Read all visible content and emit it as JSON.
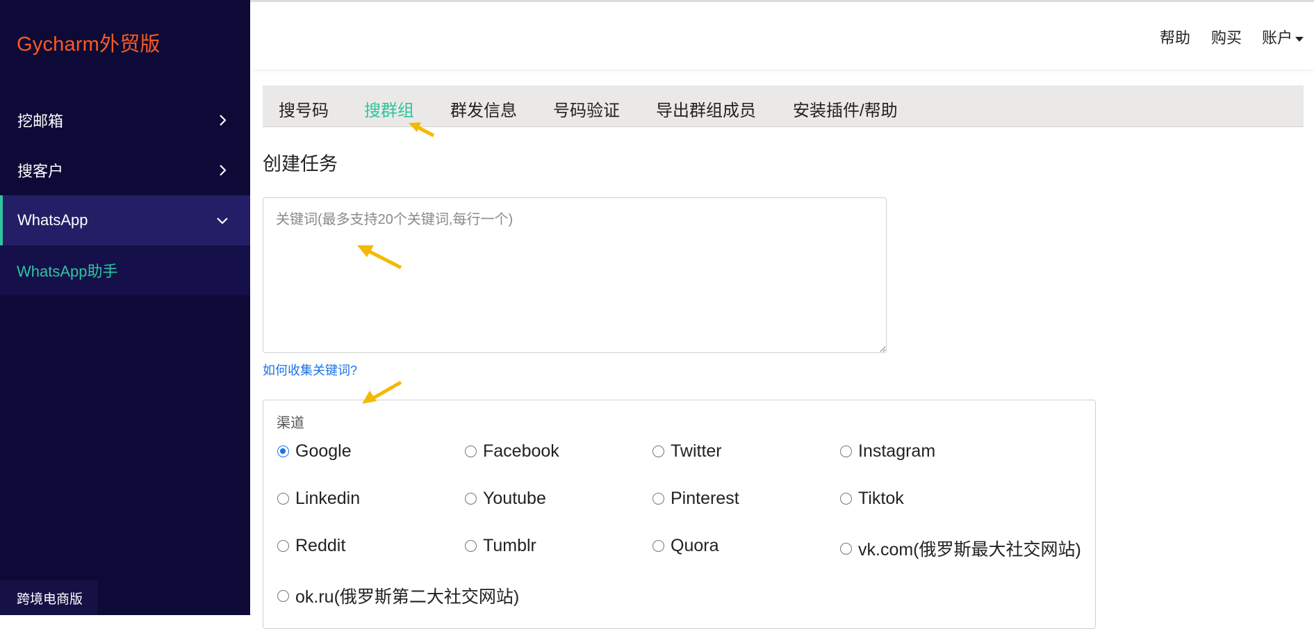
{
  "app": {
    "brand": "Gycharm外贸版",
    "footer": "跨境电商版"
  },
  "sidebar": {
    "items": [
      {
        "label": "挖邮箱",
        "icon": "chevron-right-icon"
      },
      {
        "label": "搜客户",
        "icon": "chevron-right-icon"
      },
      {
        "label": "WhatsApp",
        "icon": "chevron-down-icon",
        "active": true
      }
    ],
    "sub_item": "WhatsApp助手"
  },
  "header": {
    "help": "帮助",
    "buy": "购买",
    "account": "账户"
  },
  "tabs": [
    {
      "label": "搜号码"
    },
    {
      "label": "搜群组",
      "active": true
    },
    {
      "label": "群发信息"
    },
    {
      "label": "号码验证"
    },
    {
      "label": "导出群组成员"
    },
    {
      "label": "安装插件/帮助"
    }
  ],
  "main": {
    "title": "创建任务",
    "keyword_placeholder": "关键词(最多支持20个关键词,每行一个)",
    "keyword_value": "",
    "help_link": "如何收集关键词?",
    "channel_label": "渠道",
    "channels": [
      {
        "label": "Google",
        "checked": true
      },
      {
        "label": "Facebook",
        "checked": false
      },
      {
        "label": "Twitter",
        "checked": false
      },
      {
        "label": "Instagram",
        "checked": false
      },
      {
        "label": "Linkedin",
        "checked": false
      },
      {
        "label": "Youtube",
        "checked": false
      },
      {
        "label": "Pinterest",
        "checked": false
      },
      {
        "label": "Tiktok",
        "checked": false
      },
      {
        "label": "Reddit",
        "checked": false
      },
      {
        "label": "Tumblr",
        "checked": false
      },
      {
        "label": "Quora",
        "checked": false
      },
      {
        "label": "vk.com(俄罗斯最大社交网站)",
        "checked": false
      },
      {
        "label": "ok.ru(俄罗斯第二大社交网站)",
        "checked": false
      }
    ]
  },
  "colors": {
    "sidebar_bg": "#0d0a37",
    "brand": "#ff5a1f",
    "accent": "#2ec5a0",
    "link": "#1a73e8",
    "annotation_arrow": "#f5b800"
  }
}
